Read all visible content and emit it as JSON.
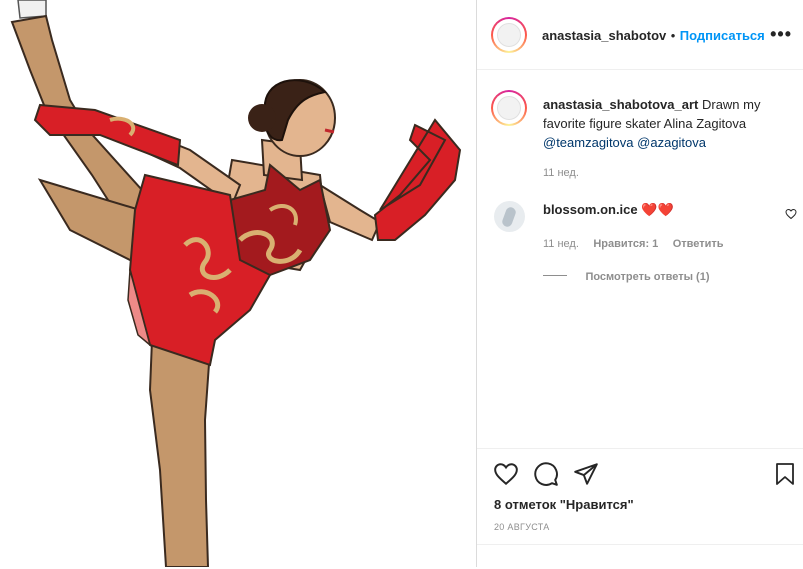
{
  "post": {
    "author": "anastasia_shabotova_art",
    "author_header": "anastasia_shabotov",
    "follow_label": "Подписаться",
    "separator": "•",
    "more_label": "•••"
  },
  "caption": {
    "username": "anastasia_shabotova_art",
    "text": " Drawn my favorite figure skater Alina Zagitova ",
    "mention1": "@teamzagitova",
    "mention2": "@azagitova",
    "time": "11 нед."
  },
  "comment": {
    "username": "blossom.on.ice",
    "emoji": "❤️❤️",
    "time": "11 нед.",
    "likes": "Нравится: 1",
    "reply": "Ответить",
    "view_replies": "Посмотреть ответы (1)"
  },
  "footer": {
    "likes_text": "8 отметок \"Нравится\"",
    "date": "20 АВГУСТА"
  },
  "icons": {
    "like": "heart-icon",
    "comment": "comment-icon",
    "share": "paper-plane-icon",
    "save": "bookmark-icon"
  },
  "colors": {
    "follow": "#0095f6",
    "mention": "#00376b",
    "dress_red": "#d81f26",
    "skin": "#b98a62"
  }
}
